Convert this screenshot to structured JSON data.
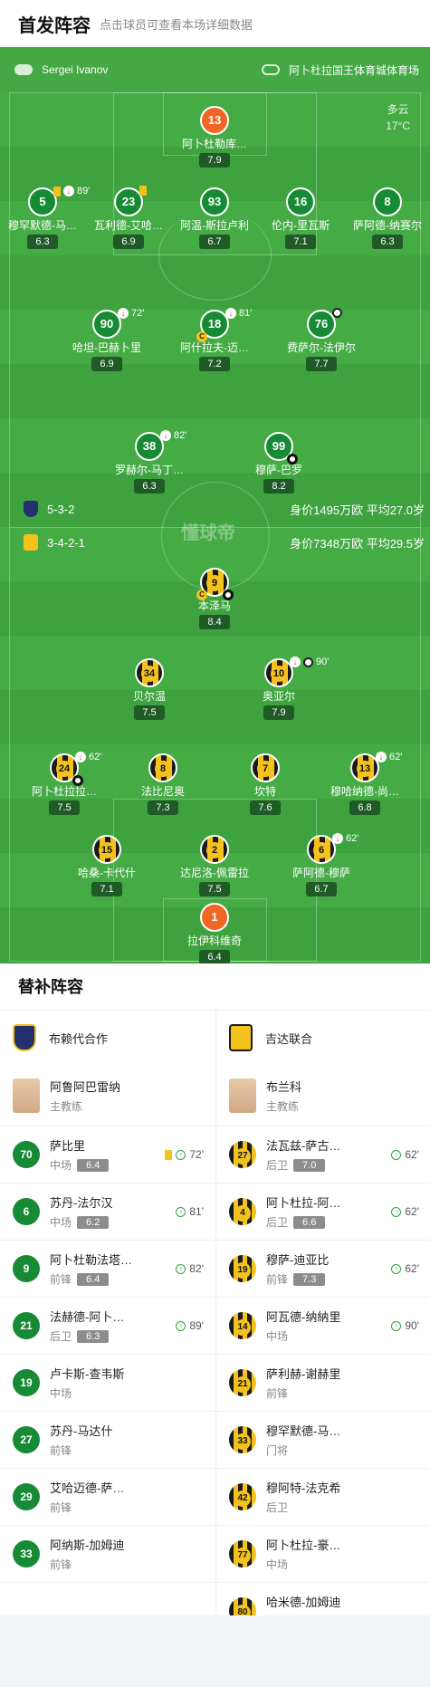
{
  "header": {
    "title": "首发阵容",
    "subtitle": "点击球员可查看本场详细数据"
  },
  "match": {
    "referee": "Sergei Ivanov",
    "venue": "阿卜杜拉国王体育城体育场",
    "weather": "多云",
    "temperature": "17°C",
    "watermark": "懂球帝"
  },
  "home": {
    "formation": "5-3-2",
    "value_info": "身价1495万欧 平均27.0岁",
    "players": [
      {
        "num": "13",
        "name": "阿卜杜勒库…",
        "rating": "7.9",
        "kind": "gk"
      },
      {
        "num": "5",
        "name": "穆罕默德-马…",
        "rating": "6.3",
        "kind": "g",
        "event": "89'"
      },
      {
        "num": "23",
        "name": "瓦利德-艾哈…",
        "rating": "6.9",
        "kind": "g",
        "event": ""
      },
      {
        "num": "93",
        "name": "阿温-斯拉卢利",
        "rating": "6.7",
        "kind": "g",
        "event": ""
      },
      {
        "num": "16",
        "name": "伦内-里瓦斯",
        "rating": "7.1",
        "kind": "g",
        "event": ""
      },
      {
        "num": "8",
        "name": "萨阿德-纳赛尔",
        "rating": "6.3",
        "kind": "g",
        "event": ""
      },
      {
        "num": "90",
        "name": "哈坦-巴赫卜里",
        "rating": "6.9",
        "kind": "g",
        "event": "72'"
      },
      {
        "num": "18",
        "name": "阿什拉夫-迈…",
        "rating": "7.2",
        "kind": "g",
        "event": "81'"
      },
      {
        "num": "76",
        "name": "费萨尔-法伊尔",
        "rating": "7.7",
        "kind": "g",
        "event": ""
      },
      {
        "num": "38",
        "name": "罗赫尔-马丁…",
        "rating": "6.3",
        "kind": "g",
        "event": "82'"
      },
      {
        "num": "99",
        "name": "穆萨-巴罗",
        "rating": "8.2",
        "kind": "g",
        "event": ""
      }
    ]
  },
  "away": {
    "formation": "3-4-2-1",
    "value_info": "身价7348万欧 平均29.5岁",
    "players": [
      {
        "num": "9",
        "name": "本泽马",
        "rating": "8.4",
        "kind": "y",
        "event": ""
      },
      {
        "num": "34",
        "name": "贝尔温",
        "rating": "7.5",
        "kind": "y",
        "event": ""
      },
      {
        "num": "10",
        "name": "奥亚尔",
        "rating": "7.9",
        "kind": "y",
        "event": "90'"
      },
      {
        "num": "24",
        "name": "阿卜杜拉拉…",
        "rating": "7.5",
        "kind": "y",
        "event": "62'"
      },
      {
        "num": "8",
        "name": "法比尼奥",
        "rating": "7.3",
        "kind": "y",
        "event": ""
      },
      {
        "num": "7",
        "name": "坎特",
        "rating": "7.6",
        "kind": "y",
        "event": ""
      },
      {
        "num": "13",
        "name": "穆哈纳德-尚…",
        "rating": "6.8",
        "kind": "y",
        "event": "62'"
      },
      {
        "num": "15",
        "name": "哈桑-卡代什",
        "rating": "7.1",
        "kind": "y",
        "event": ""
      },
      {
        "num": "2",
        "name": "达尼洛-佩雷拉",
        "rating": "7.5",
        "kind": "y",
        "event": ""
      },
      {
        "num": "6",
        "name": "萨阿德-穆萨",
        "rating": "6.7",
        "kind": "y",
        "event": "62'"
      },
      {
        "num": "1",
        "name": "拉伊科维奇",
        "rating": "6.4",
        "kind": "gk",
        "event": ""
      }
    ]
  },
  "subs": {
    "title": "替补阵容",
    "home": {
      "team": "布赖代合作",
      "coach": "阿鲁阿巴雷纳",
      "coach_role": "主教练",
      "players": [
        {
          "num": "70",
          "name": "萨比里",
          "pos": "中场",
          "rating": "6.4",
          "event": "72'"
        },
        {
          "num": "6",
          "name": "苏丹-法尔汉",
          "pos": "中场",
          "rating": "6.2",
          "event": "81'"
        },
        {
          "num": "9",
          "name": "阿卜杜勒法塔…",
          "pos": "前锋",
          "rating": "6.4",
          "event": "82'"
        },
        {
          "num": "21",
          "name": "法赫德-阿卜…",
          "pos": "后卫",
          "rating": "6.3",
          "event": "89'"
        },
        {
          "num": "19",
          "name": "卢卡斯-查韦斯",
          "pos": "中场",
          "rating": "",
          "event": ""
        },
        {
          "num": "27",
          "name": "苏丹-马达什",
          "pos": "前锋",
          "rating": "",
          "event": ""
        },
        {
          "num": "29",
          "name": "艾哈迈德-萨…",
          "pos": "前锋",
          "rating": "",
          "event": ""
        },
        {
          "num": "33",
          "name": "阿纳斯-加姆迪",
          "pos": "前锋",
          "rating": "",
          "event": ""
        }
      ]
    },
    "away": {
      "team": "吉达联合",
      "coach": "布兰科",
      "coach_role": "主教练",
      "players": [
        {
          "num": "27",
          "name": "法瓦兹-萨古…",
          "pos": "后卫",
          "rating": "7.0",
          "event": "62'"
        },
        {
          "num": "4",
          "name": "阿卜杜拉-阿…",
          "pos": "后卫",
          "rating": "6.6",
          "event": "62'"
        },
        {
          "num": "19",
          "name": "穆萨-迪亚比",
          "pos": "前锋",
          "rating": "7.3",
          "event": "62'"
        },
        {
          "num": "14",
          "name": "阿瓦德-纳納里",
          "pos": "中场",
          "rating": "",
          "event": "90'"
        },
        {
          "num": "21",
          "name": "萨利赫-谢赫里",
          "pos": "前锋",
          "rating": "",
          "event": ""
        },
        {
          "num": "33",
          "name": "穆罕默德-马…",
          "pos": "门将",
          "rating": "",
          "event": ""
        },
        {
          "num": "42",
          "name": "穆阿特-法克希",
          "pos": "后卫",
          "rating": "",
          "event": ""
        },
        {
          "num": "77",
          "name": "阿卜杜拉-豪…",
          "pos": "中场",
          "rating": "",
          "event": ""
        },
        {
          "num": "80",
          "name": "哈米德-加姆迪",
          "pos": "中场",
          "rating": "",
          "event": ""
        }
      ]
    }
  }
}
